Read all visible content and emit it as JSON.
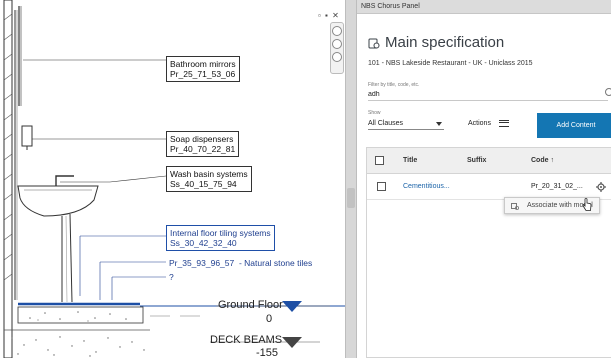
{
  "drawing": {
    "tags": [
      {
        "name": "Bathroom mirrors",
        "code": "Pr_25_71_53_06"
      },
      {
        "name": "Soap dispensers",
        "code": "Pr_40_70_22_81"
      },
      {
        "name": "Wash basin systems",
        "code": "Ss_40_15_75_94"
      },
      {
        "name": "Internal floor tiling systems",
        "code": "Ss_30_42_32_40"
      }
    ],
    "annotation_code": "Pr_35_93_96_57",
    "annotation_text": "- Natural stone tiles",
    "annotation_unknown": "?",
    "levels": [
      {
        "name": "Ground Floor",
        "value": "0"
      },
      {
        "name": "DECK BEAMS",
        "value": "-155"
      }
    ],
    "window_controls": "▫ ▪ ✕"
  },
  "panel": {
    "window_title": "NBS Chorus Panel",
    "heading": "Main specification",
    "project": "101 - NBS Lakeside Restaurant - UK - Uniclass 2015",
    "filter_label": "Filter by title, code, etc.",
    "filter_value": "adh",
    "show_label": "Show",
    "show_value": "All Clauses",
    "actions_label": "Actions",
    "add_button": "Add Content",
    "table": {
      "columns": [
        "Title",
        "Suffix",
        "Code ↑"
      ],
      "rows": [
        {
          "title": "Cementitious...",
          "suffix": "",
          "code": "Pr_20_31_02_..."
        }
      ]
    },
    "popup_label": "Associate with model"
  },
  "colors": {
    "accent": "#1476b3",
    "link": "#1b63a8",
    "tag_selected": "#1f4fa8",
    "level_marker": "#1d4fa5"
  }
}
